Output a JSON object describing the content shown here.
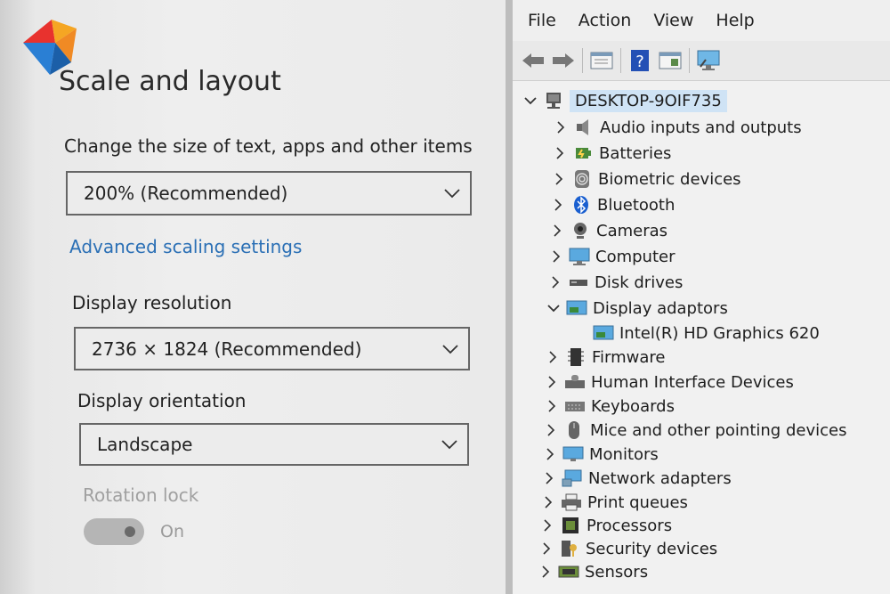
{
  "settings": {
    "heading": "Scale and layout",
    "scale_label": "Change the size of text, apps and other items",
    "scale_value": "200% (Recommended)",
    "advanced_link": "Advanced scaling settings",
    "resolution_label": "Display resolution",
    "resolution_value": "2736 × 1824 (Recommended)",
    "orientation_label": "Display orientation",
    "orientation_value": "Landscape",
    "rotation_label": "Rotation lock",
    "rotation_state": "On"
  },
  "device_manager": {
    "menu": [
      "File",
      "Action",
      "View",
      "Help"
    ],
    "root": "DESKTOP-9OIF735",
    "nodes": [
      {
        "label": "Audio inputs and outputs",
        "icon": "speaker-icon"
      },
      {
        "label": "Batteries",
        "icon": "battery-icon"
      },
      {
        "label": "Biometric devices",
        "icon": "fingerprint-icon"
      },
      {
        "label": "Bluetooth",
        "icon": "bluetooth-icon"
      },
      {
        "label": "Cameras",
        "icon": "webcam-icon"
      },
      {
        "label": "Computer",
        "icon": "computer-icon"
      },
      {
        "label": "Disk drives",
        "icon": "disk-icon"
      },
      {
        "label": "Display adaptors",
        "icon": "display-adapter-icon",
        "expanded": true
      },
      {
        "label": "Intel(R) HD Graphics 620",
        "icon": "display-adapter-icon",
        "child": true
      },
      {
        "label": "Firmware",
        "icon": "firmware-icon"
      },
      {
        "label": "Human Interface Devices",
        "icon": "hid-icon"
      },
      {
        "label": "Keyboards",
        "icon": "keyboard-icon"
      },
      {
        "label": "Mice and other pointing devices",
        "icon": "mouse-icon"
      },
      {
        "label": "Monitors",
        "icon": "monitor-icon"
      },
      {
        "label": "Network adapters",
        "icon": "network-icon"
      },
      {
        "label": "Print queues",
        "icon": "printer-icon"
      },
      {
        "label": "Processors",
        "icon": "processor-icon"
      },
      {
        "label": "Security devices",
        "icon": "security-icon"
      },
      {
        "label": "Sensors",
        "icon": "sensor-icon"
      }
    ]
  },
  "colors": {
    "link": "#2a6fb5",
    "selection": "#cfe3f5"
  }
}
